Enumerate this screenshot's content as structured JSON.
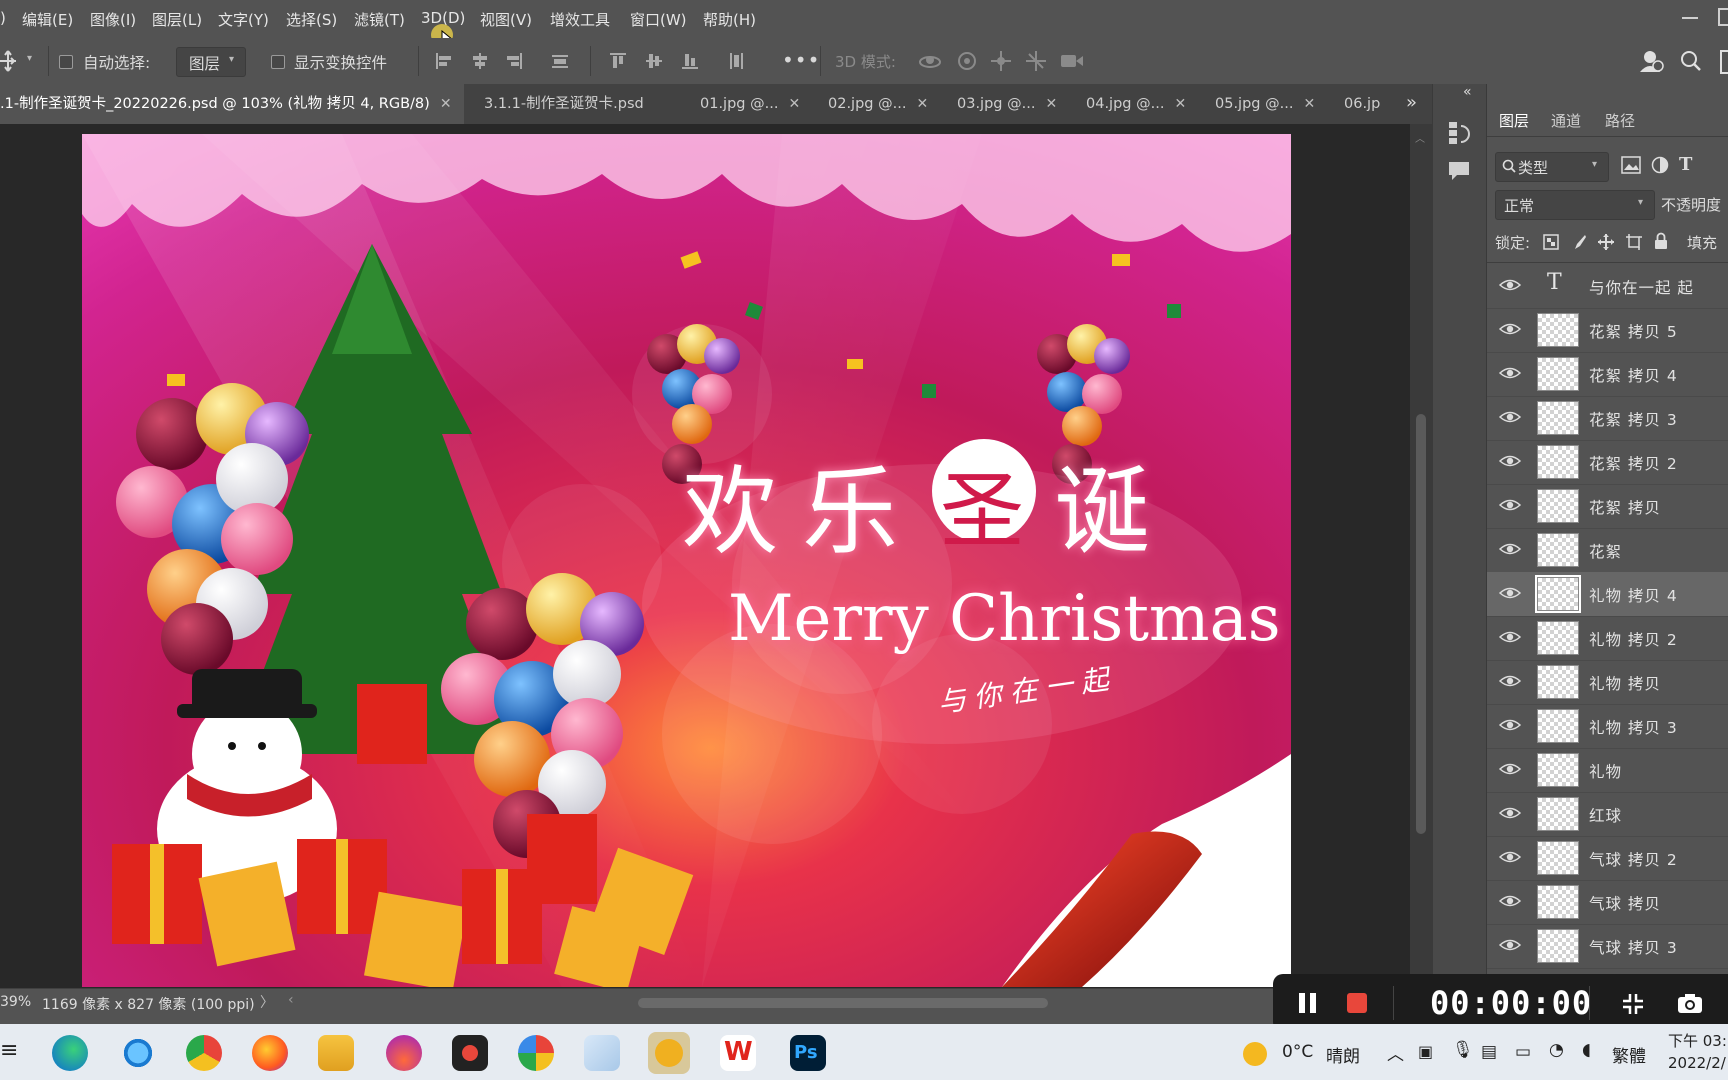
{
  "menubar": {
    "items": [
      "编辑(E)",
      "图像(I)",
      "图层(L)",
      "文字(Y)",
      "选择(S)",
      "滤镜(T)",
      "3D(D)",
      "视图(V)",
      "增效工具",
      "窗口(W)",
      "帮助(H)"
    ],
    "left_fragment": ")"
  },
  "options": {
    "auto_select_label": "自动选择:",
    "auto_select_target": "图层",
    "show_transform_label": "显示变换控件",
    "mode_3d_label": "3D 模式:"
  },
  "tabs": [
    {
      "label": ".1-制作圣诞贺卡_20220226.psd @ 103% (礼物 拷贝 4, RGB/8)",
      "active": true
    },
    {
      "label": "3.1.1-制作圣诞贺卡.psd",
      "active": false
    },
    {
      "label": "01.jpg @...",
      "active": false
    },
    {
      "label": "02.jpg @...",
      "active": false
    },
    {
      "label": "03.jpg @...",
      "active": false
    },
    {
      "label": "04.jpg @...",
      "active": false
    },
    {
      "label": "05.jpg @...",
      "active": false
    },
    {
      "label": "06.jp",
      "active": false
    }
  ],
  "canvas_art": {
    "title_chars": [
      "欢",
      "乐",
      "圣",
      "诞"
    ],
    "subtitle": "Merry Christmas",
    "tagline": "与你在一起"
  },
  "panel": {
    "tabs": [
      "图层",
      "通道",
      "路径"
    ],
    "filter_label": "类型",
    "blend_mode": "正常",
    "opacity_label": "不透明度",
    "lock_label": "锁定:",
    "fill_label": "填充"
  },
  "layers": [
    {
      "name": "与你在一起 起",
      "type": "text",
      "selected": false
    },
    {
      "name": "花絮 拷贝 5",
      "type": "pixel",
      "selected": false
    },
    {
      "name": "花絮 拷贝 4",
      "type": "pixel",
      "selected": false
    },
    {
      "name": "花絮 拷贝 3",
      "type": "pixel",
      "selected": false
    },
    {
      "name": "花絮 拷贝 2",
      "type": "pixel",
      "selected": false
    },
    {
      "name": "花絮 拷贝",
      "type": "pixel",
      "selected": false
    },
    {
      "name": "花絮",
      "type": "pixel",
      "selected": false
    },
    {
      "name": "礼物 拷贝 4",
      "type": "pixel",
      "selected": true
    },
    {
      "name": "礼物 拷贝 2",
      "type": "pixel",
      "selected": false
    },
    {
      "name": "礼物 拷贝",
      "type": "pixel",
      "selected": false
    },
    {
      "name": "礼物 拷贝 3",
      "type": "pixel",
      "selected": false
    },
    {
      "name": "礼物",
      "type": "pixel",
      "selected": false
    },
    {
      "name": "红球",
      "type": "pixel",
      "selected": false
    },
    {
      "name": "气球 拷贝 2",
      "type": "pixel",
      "selected": false
    },
    {
      "name": "气球 拷贝",
      "type": "pixel",
      "selected": false
    },
    {
      "name": "气球 拷贝 3",
      "type": "pixel",
      "selected": false
    }
  ],
  "status": {
    "zoom": "39%",
    "doc_size": "1169 像素 x 827 像素 (100 ppi)"
  },
  "recorder": {
    "timer": "00:00:00"
  },
  "taskbar": {
    "weather_temp": "0°C",
    "weather_desc": "晴朗",
    "ime": "繁體",
    "time": "下午 03:",
    "date": "2022/2/"
  },
  "colors": {
    "accent_record": "#e8473b",
    "ps_blue": "#31a8ff"
  }
}
